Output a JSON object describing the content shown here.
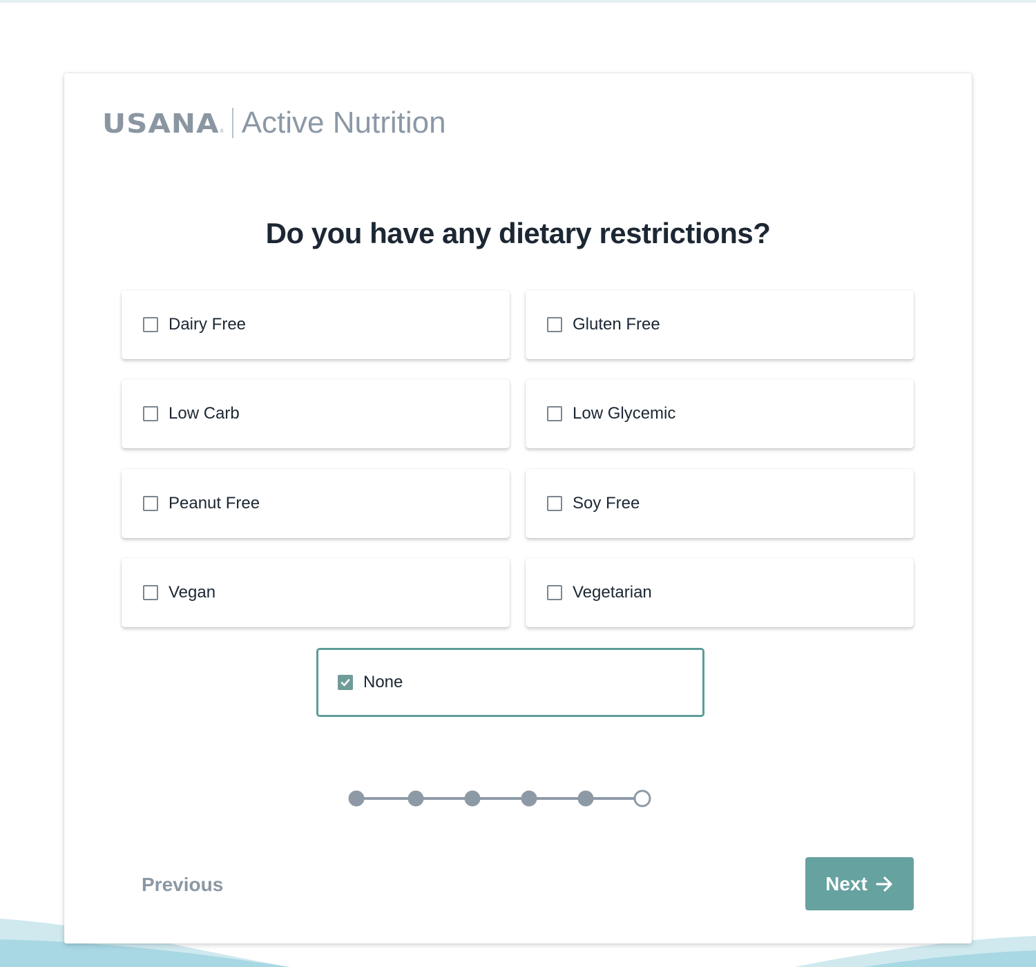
{
  "brand": {
    "logo": "USANA",
    "registered": "®",
    "product": "Active Nutrition"
  },
  "question": "Do you have any dietary restrictions?",
  "options": [
    {
      "label": "Dairy Free",
      "checked": false
    },
    {
      "label": "Gluten Free",
      "checked": false
    },
    {
      "label": "Low Carb",
      "checked": false
    },
    {
      "label": "Low Glycemic",
      "checked": false
    },
    {
      "label": "Peanut Free",
      "checked": false
    },
    {
      "label": "Soy Free",
      "checked": false
    },
    {
      "label": "Vegan",
      "checked": false
    },
    {
      "label": "Vegetarian",
      "checked": false
    },
    {
      "label": "None",
      "checked": true
    }
  ],
  "progress": {
    "total_steps": 6,
    "current_step": 6,
    "completed_steps": 5
  },
  "navigation": {
    "previous_label": "Previous",
    "next_label": "Next"
  },
  "icons": {
    "next": "arrow-right-icon",
    "checked": "check-icon"
  },
  "colors": {
    "accent": "#66a29f",
    "selected_border": "#5e9c98",
    "text_dark": "#1c2733",
    "muted": "#8a97a3",
    "progress": "#8d9aa6"
  }
}
